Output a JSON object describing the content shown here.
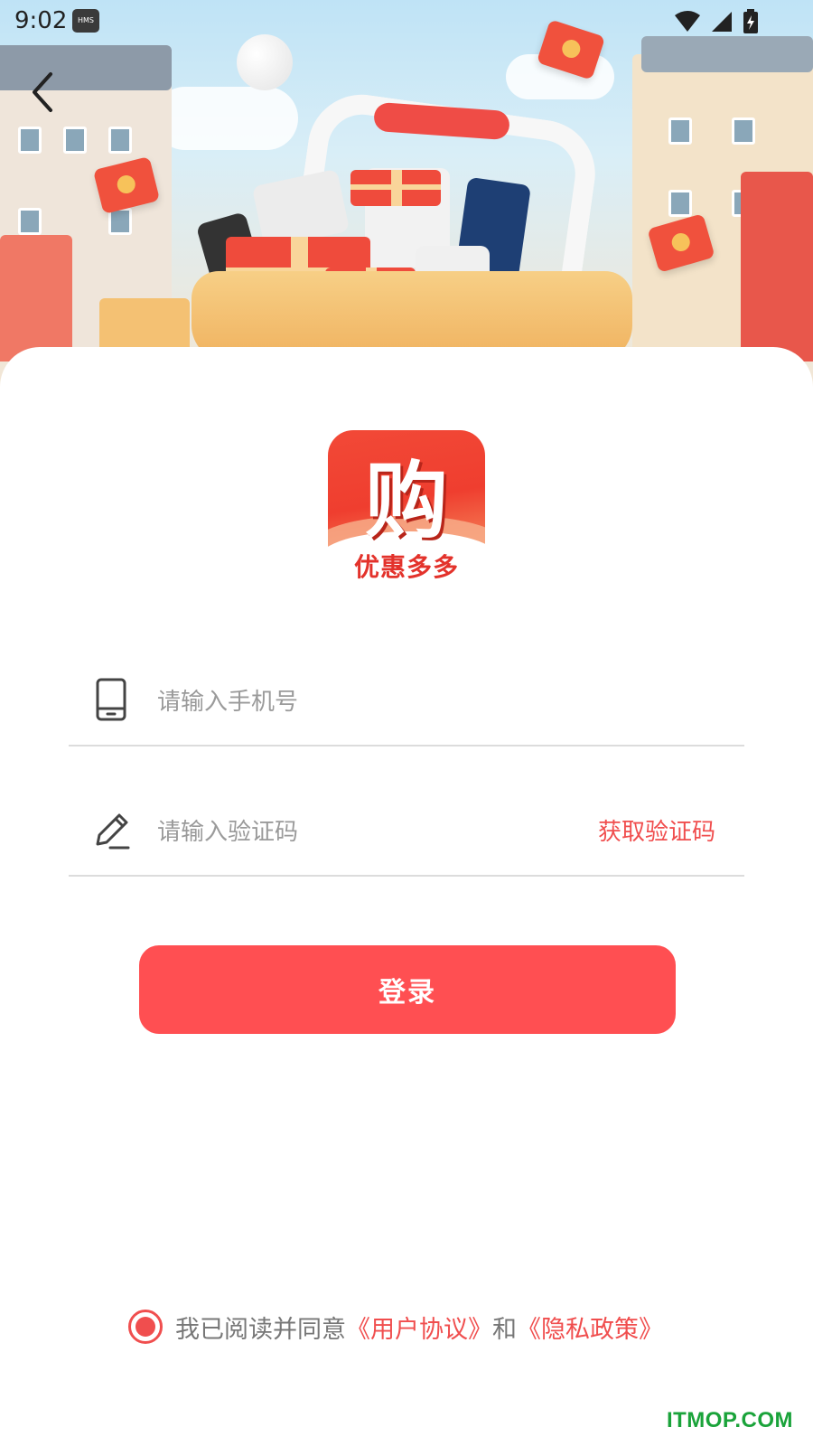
{
  "status_bar": {
    "time": "9:02",
    "hms_badge": "HMS",
    "icons": [
      "wifi-icon",
      "signal-icon",
      "battery-charging-icon"
    ]
  },
  "banner": {
    "back_icon": "chevron-left-icon"
  },
  "logo": {
    "main_char": "购",
    "tagline": "优惠多多"
  },
  "form": {
    "phone_placeholder": "请输入手机号",
    "phone_icon": "phone-icon",
    "code_placeholder": "请输入验证码",
    "code_icon": "pencil-icon",
    "get_code_label": "获取验证码",
    "login_label": "登录"
  },
  "agreement": {
    "checked": true,
    "prefix": "我已阅读并同意",
    "user_agreement": "《用户协议》",
    "conjunction": "和",
    "privacy_policy": "《隐私政策》"
  },
  "watermark": "ITMOP.COM",
  "colors": {
    "accent": "#ff4f52",
    "link": "#f04e4e",
    "placeholder": "#9a9a9a",
    "divider": "#dcdcdc",
    "watermark": "#1aa33a"
  }
}
